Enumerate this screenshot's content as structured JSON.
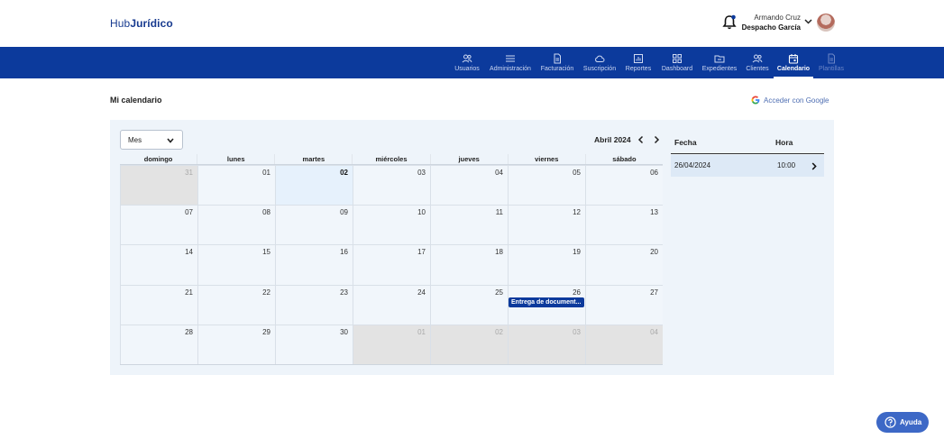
{
  "header": {
    "logo_prefix": "Hub",
    "logo_bold": "Jurídico",
    "user_name": "Armando Cruz",
    "user_org": "Despacho García"
  },
  "nav": [
    {
      "label": "Usuarios",
      "icon": "users-icon"
    },
    {
      "label": "Administración",
      "icon": "menu-icon"
    },
    {
      "label": "Facturación",
      "icon": "document-icon"
    },
    {
      "label": "Suscripción",
      "icon": "cloud-icon"
    },
    {
      "label": "Reportes",
      "icon": "chart-icon"
    },
    {
      "label": "Dashboard",
      "icon": "grid-icon"
    },
    {
      "label": "Expedientes",
      "icon": "folder-icon"
    },
    {
      "label": "Clientes",
      "icon": "clients-icon"
    },
    {
      "label": "Calendario",
      "icon": "calendar-icon",
      "active": true
    },
    {
      "label": "Plantillas",
      "icon": "template-icon",
      "disabled": true
    }
  ],
  "page": {
    "title": "Mi calendario",
    "google_link": "Acceder con Google"
  },
  "calendar": {
    "view": "Mes",
    "month_label": "Abril 2024",
    "weekdays": [
      "domingo",
      "lunes",
      "martes",
      "miércoles",
      "jueves",
      "viernes",
      "sábado"
    ],
    "days": [
      "31",
      "01",
      "02",
      "03",
      "04",
      "05",
      "06",
      "07",
      "08",
      "09",
      "10",
      "11",
      "12",
      "13",
      "14",
      "15",
      "16",
      "17",
      "18",
      "19",
      "20",
      "21",
      "22",
      "23",
      "24",
      "25",
      "26",
      "27",
      "28",
      "29",
      "30",
      "01",
      "02",
      "03",
      "04"
    ],
    "event_label": "Entrega de document..."
  },
  "side": {
    "col_date": "Fecha",
    "col_time": "Hora",
    "row_date": "26/04/2024",
    "row_time": "10:00"
  },
  "help_label": "Ayuda",
  "colors": {
    "primary": "#0c3a9c",
    "help": "#3d68c6",
    "panel": "#eef4fa"
  }
}
